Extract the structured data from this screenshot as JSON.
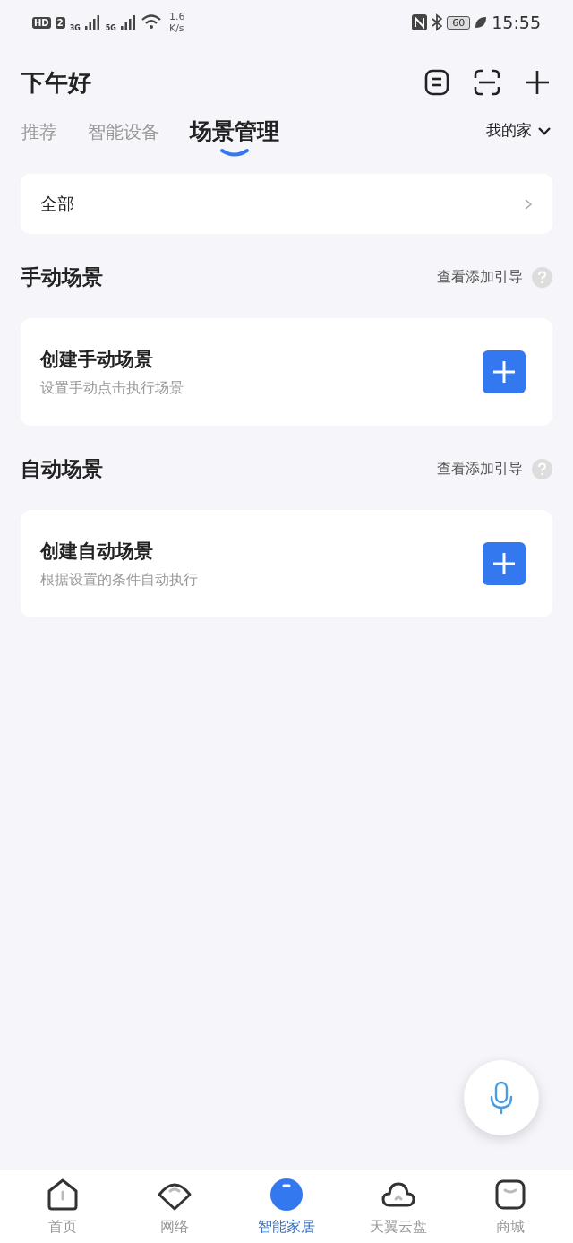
{
  "status_bar": {
    "hd": "HD",
    "sim": "2",
    "networks": [
      "3G",
      "5G"
    ],
    "speed": [
      "1.6",
      "K/s"
    ],
    "battery": "60",
    "time": "15:55"
  },
  "greeting": "下午好",
  "tabs": [
    {
      "label": "推荐",
      "selected": false
    },
    {
      "label": "智能设备",
      "selected": false
    },
    {
      "label": "场景管理",
      "selected": true
    }
  ],
  "home_selector": "我的家",
  "filter": {
    "label": "全部"
  },
  "sections": [
    {
      "title": "手动场景",
      "guide": "查看添加引导",
      "card": {
        "title": "创建手动场景",
        "subtitle": "设置手动点击执行场景"
      }
    },
    {
      "title": "自动场景",
      "guide": "查看添加引导",
      "card": {
        "title": "创建自动场景",
        "subtitle": "根据设置的条件自动执行"
      }
    }
  ],
  "nav": [
    {
      "kind": "home",
      "label": "首页",
      "selected": false
    },
    {
      "kind": "network",
      "label": "网络",
      "selected": false
    },
    {
      "kind": "smart",
      "label": "智能家居",
      "selected": true
    },
    {
      "kind": "cloud",
      "label": "天翼云盘",
      "selected": false
    },
    {
      "kind": "shop",
      "label": "商城",
      "selected": false
    }
  ]
}
